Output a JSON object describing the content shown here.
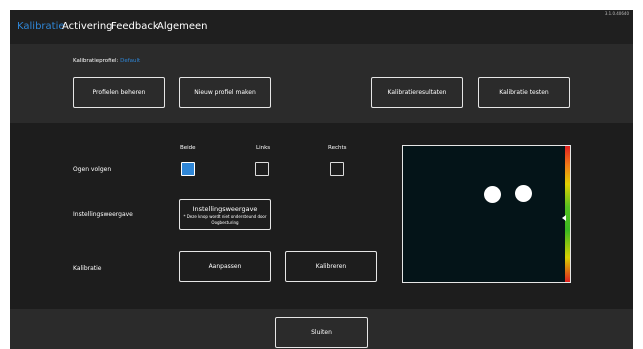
{
  "window": {
    "version": "3.1.0.40640"
  },
  "tabs": [
    {
      "label": "Kalibratie",
      "active": true
    },
    {
      "label": "Activering",
      "active": false
    },
    {
      "label": "Feedback",
      "active": false
    },
    {
      "label": "Algemeen",
      "active": false
    }
  ],
  "profile": {
    "label": "Kalibratieprofiel:",
    "name": "Default"
  },
  "actions": {
    "manage_profiles": "Profielen beheren",
    "new_profile": "Nieuw profiel maken",
    "results": "Kalibratieresultaten",
    "test": "Kalibratie testen"
  },
  "eyes_follow": {
    "label": "Ogen volgen",
    "options": [
      {
        "label": "Beide",
        "checked": true
      },
      {
        "label": "Links",
        "checked": false
      },
      {
        "label": "Rechts",
        "checked": false
      }
    ]
  },
  "settings_view": {
    "label": "Instellingsweergave",
    "button_title": "Instellingsweergave",
    "button_note_line1": "* Deze knop wordt niet ondersteund door",
    "button_note_line2": "Oogbesturing"
  },
  "calibration": {
    "label": "Kalibratie",
    "adjust": "Aanpassen",
    "calibrate": "Kalibreren"
  },
  "footer": {
    "close": "Sluiten"
  },
  "colors": {
    "accent": "#2f86d6",
    "panel": "#1d1d1d",
    "background": "#2b2b2b",
    "topbar": "#1f1f1f",
    "preview": "#041418"
  }
}
